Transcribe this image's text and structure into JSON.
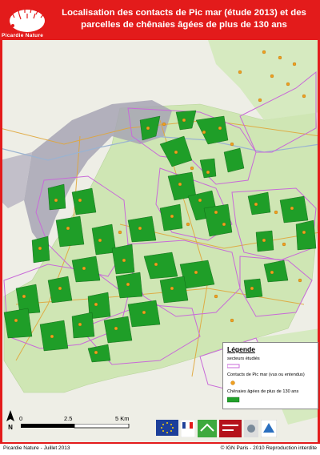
{
  "header": {
    "title": "Localisation des contacts de Pic mar (étude 2013) et des parcelles de chênaies âgées de plus de 130 ans",
    "org_name": "Picardie Nature"
  },
  "legend": {
    "title": "Légende",
    "items": [
      {
        "label": "secteurs étudiés",
        "symbol": "line",
        "color": "#c86ad8"
      },
      {
        "label": "Contacts de Pic mar (vus ou entendus)",
        "symbol": "dot",
        "color": "#f0a020"
      },
      {
        "label": "Chênaies âgées de plus de 130 ans",
        "symbol": "fill",
        "color": "#22a12a"
      }
    ]
  },
  "scale": {
    "labels": [
      "0",
      "2.5",
      "5 Km"
    ]
  },
  "footer": {
    "left": "Picardie Nature - Juillet 2013",
    "right": "© IGN Paris - 2010 Reproduction interdite"
  },
  "colors": {
    "brand_red": "#e31b1b",
    "forest": "#cfe6b4",
    "urban": "#9a98a8",
    "sector": "#c86ad8",
    "oak": "#1f9e28",
    "contact": "#f0a020"
  }
}
